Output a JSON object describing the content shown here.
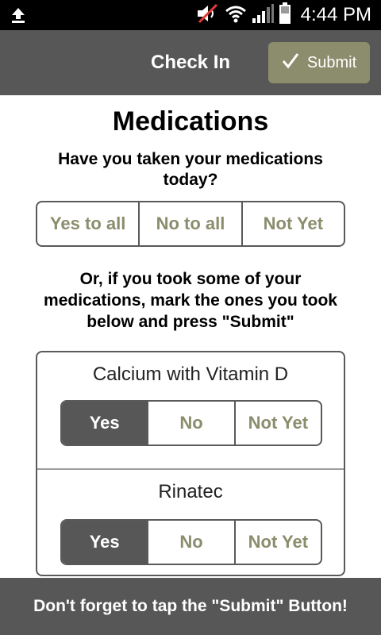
{
  "status_bar": {
    "time": "4:44 PM",
    "icons": [
      "upload-icon",
      "volume-muted-icon",
      "wifi-icon",
      "signal-icon",
      "battery-icon"
    ]
  },
  "header": {
    "title": "Check In",
    "submit_label": "Submit",
    "submit_icon": "checkmark-icon"
  },
  "main": {
    "heading": "Medications",
    "question": "Have you taken your medications today?",
    "all_options": [
      "Yes to all",
      "No to all",
      "Not Yet"
    ],
    "instructions": "Or, if you took some of your medications, mark the ones you took below and press \"Submit\"",
    "medications": [
      {
        "name": "Calcium with Vitamin D",
        "options": [
          "Yes",
          "No",
          "Not Yet"
        ],
        "selected": "Yes"
      },
      {
        "name": "Rinatec",
        "options": [
          "Yes",
          "No",
          "Not Yet"
        ],
        "selected": "Yes"
      }
    ]
  },
  "footer": {
    "message": "Don't forget to tap the \"Submit\" Button!"
  },
  "colors": {
    "header_bg": "#575757",
    "accent_olive": "#8b8d6c",
    "selected_bg": "#575757",
    "border": "#5a5a5a"
  }
}
